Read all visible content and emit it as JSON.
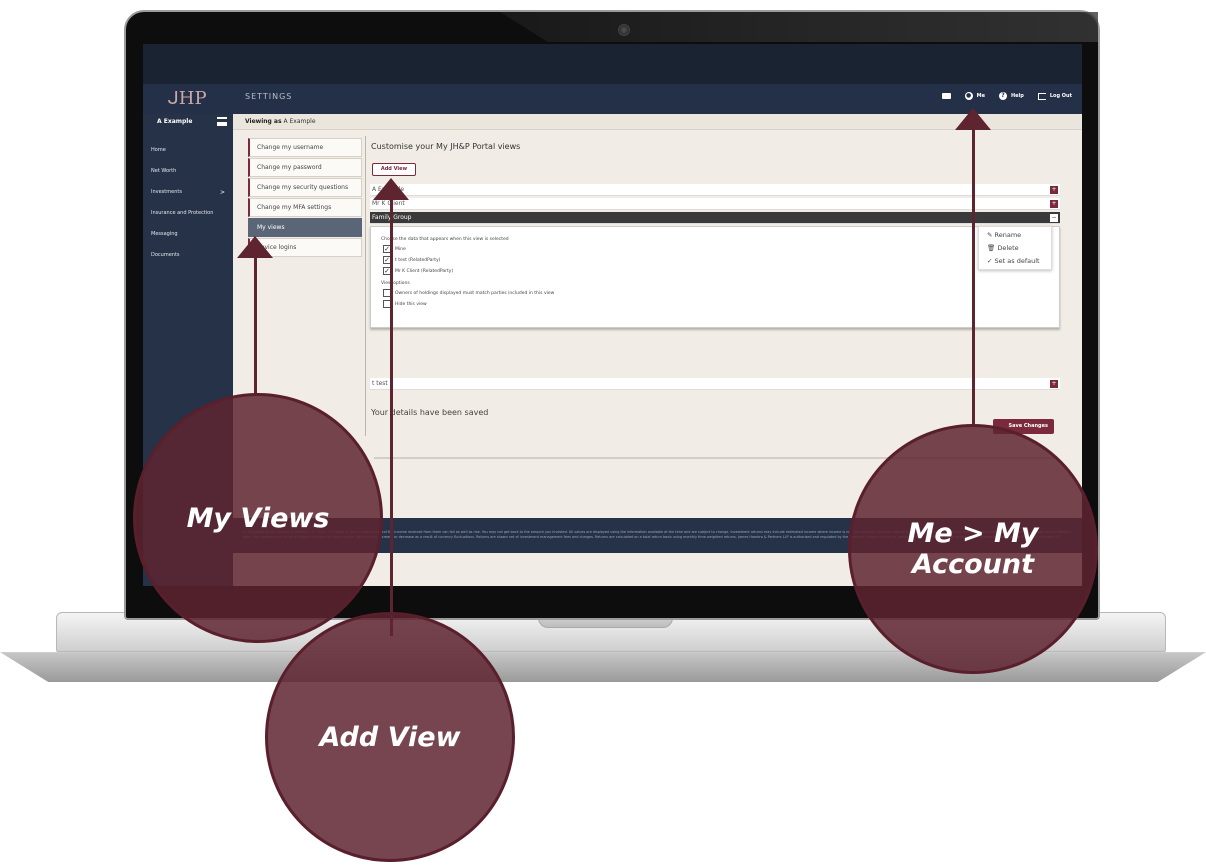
{
  "header": {
    "title": "SETTINGS",
    "logo_text": "JHP",
    "items": [
      {
        "label": "",
        "icon": "envelope-icon"
      },
      {
        "label": "Me",
        "icon": "user-icon"
      },
      {
        "label": "Help",
        "icon": "help-icon"
      },
      {
        "label": "Log Out",
        "icon": "logout-icon"
      }
    ]
  },
  "sidebar": {
    "account_name": "A Example",
    "items": [
      {
        "label": "Home"
      },
      {
        "label": "Net Worth"
      },
      {
        "label": "Investments",
        "chevron": ">"
      },
      {
        "label": "Insurance and Protection"
      },
      {
        "label": "Messaging"
      },
      {
        "label": "Documents"
      }
    ]
  },
  "viewing": {
    "prefix": "Viewing as",
    "name": "A Example"
  },
  "settings_nav": {
    "items": [
      {
        "label": "Change my username"
      },
      {
        "label": "Change my password"
      },
      {
        "label": "Change my security questions"
      },
      {
        "label": "Change my MFA settings"
      },
      {
        "label": "My views"
      },
      {
        "label": "device logins"
      }
    ]
  },
  "views_panel": {
    "title": "Customise your My JH&P Portal views",
    "add_view_label": "Add View",
    "rows": [
      "A Example",
      "Mr K Client",
      "Family Group",
      "t test"
    ],
    "expanded": {
      "choose_label": "Choose the data that appears when this view is selected",
      "options": [
        "Mine",
        "t test (RelatedParty)",
        "Mr K Client (RelatedParty)"
      ],
      "view_options_label": "View options",
      "view_options": [
        "Owners of holdings displayed must match parties included in this view",
        "Hide this view"
      ]
    },
    "menu": [
      "Rename",
      "Delete",
      "Set as default"
    ],
    "saved_message": "Your details have been saved",
    "save_label": "Save Changes"
  },
  "footer": {
    "text": "© Copyright James Hambro & Partners LLP 2023. The value of your investments and the income received from them can fall as well as rise. You may not get back to the amount you invested. All values are displayed using the information available at the time and are subject to change. Investment returns may include estimated income where income is not yet received. Valuation adjustments are required for instance to reflect dividend payments declared but not paid at the relevant date. Past performance is not a reliable indicator of future results. Returns may increase or decrease as a result of currency fluctuations. Returns are shown net of investment management fees and charges. Returns are calculated on a total return basis using monthly time-weighted returns. James Hambro & Partners LLP is authorised and regulated by the Financial Conduct Authority. James Hambro & Company Ltd is an Appointed Representative of James Hambro & Partners LLP."
  },
  "callouts": {
    "my_views": "My Views",
    "add_view": "Add View",
    "me_account": "Me > My Account"
  },
  "colors": {
    "accent": "#7a2a3a",
    "bubble": "#5e2430",
    "header": "#233047"
  }
}
